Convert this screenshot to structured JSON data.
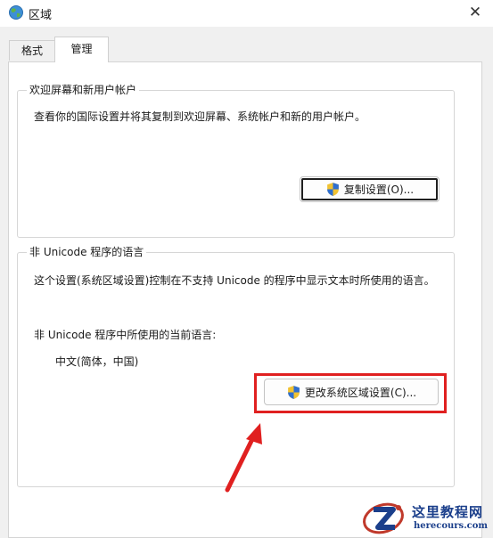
{
  "window": {
    "title": "区域",
    "close_symbol": "✕"
  },
  "tabs": [
    {
      "label": "格式",
      "selected": false
    },
    {
      "label": "管理",
      "selected": true
    }
  ],
  "welcome_group": {
    "title": "欢迎屏幕和新用户帐户",
    "description": "查看你的国际设置并将其复制到欢迎屏幕、系统帐户和新的用户帐户。",
    "copy_button": "复制设置(O)..."
  },
  "non_unicode_group": {
    "title": "非 Unicode 程序的语言",
    "description": "这个设置(系统区域设置)控制在不支持 Unicode 的程序中显示文本时所使用的语言。",
    "current_label": "非 Unicode 程序中所使用的当前语言:",
    "current_value": "中文(简体，中国)",
    "change_button": "更改系统区域设置(C)..."
  },
  "annotation": {
    "highlight_color": "#e02020"
  },
  "watermark": {
    "title": "这里教程网",
    "url": "herecours.com"
  }
}
